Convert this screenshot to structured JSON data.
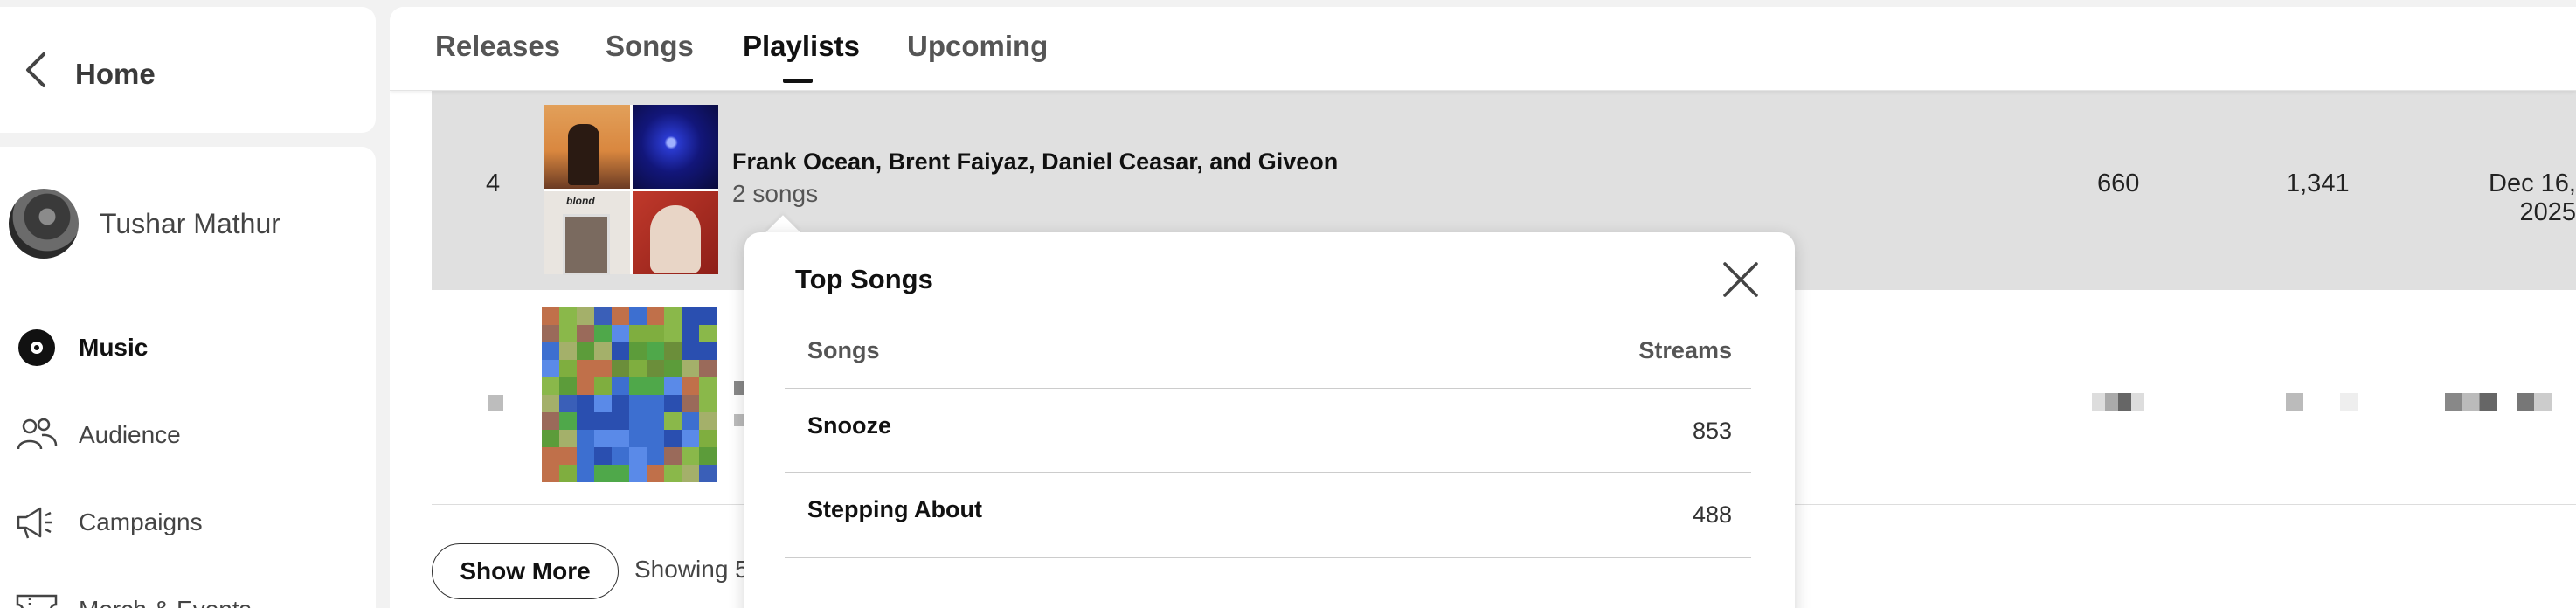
{
  "sidebar": {
    "home_label": "Home",
    "user_name": "Tushar Mathur",
    "items": [
      {
        "label": "Music",
        "icon": "disc-icon",
        "active": true
      },
      {
        "label": "Audience",
        "icon": "audience-icon",
        "active": false
      },
      {
        "label": "Campaigns",
        "icon": "megaphone-icon",
        "active": false
      },
      {
        "label": "Merch & Events",
        "icon": "ticket-icon",
        "active": false
      }
    ]
  },
  "tabs": [
    {
      "label": "Releases",
      "active": false
    },
    {
      "label": "Songs",
      "active": false
    },
    {
      "label": "Playlists",
      "active": true
    },
    {
      "label": "Upcoming",
      "active": false
    }
  ],
  "rows": [
    {
      "rank": "4",
      "title": "Frank Ocean, Brent Faiyaz, Daniel Ceasar, and Giveon",
      "subtitle": "2 songs",
      "col1": "660",
      "col2": "1,341",
      "date": "Dec 16, 2025"
    }
  ],
  "footer": {
    "show_more_label": "Show More",
    "showing_text": "Showing 5"
  },
  "popup": {
    "title": "Top Songs",
    "col_songs": "Songs",
    "col_streams": "Streams",
    "songs": [
      {
        "name": "Snooze",
        "streams": "853"
      },
      {
        "name": "Stepping About",
        "streams": "488"
      }
    ]
  },
  "colors": {
    "highlight_row": "#e0e0e0",
    "accent_text": "#111111",
    "muted_text": "#555555"
  }
}
